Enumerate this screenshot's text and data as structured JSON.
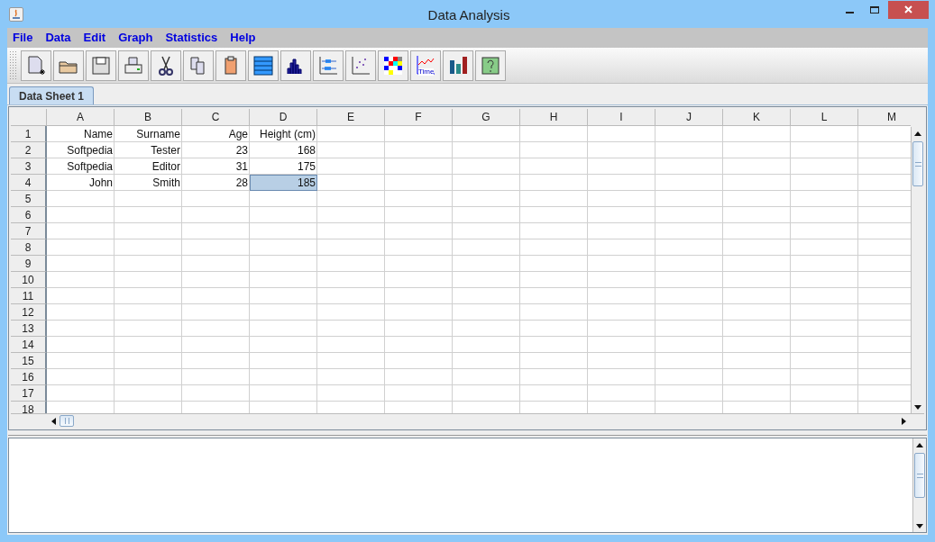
{
  "window": {
    "title": "Data Analysis"
  },
  "menu": [
    "File",
    "Data",
    "Edit",
    "Graph",
    "Statistics",
    "Help"
  ],
  "toolbar": [
    {
      "kind": "new"
    },
    {
      "kind": "open"
    },
    {
      "kind": "save"
    },
    {
      "kind": "print"
    },
    {
      "kind": "cut"
    },
    {
      "kind": "copy"
    },
    {
      "kind": "paste"
    },
    {
      "kind": "sheet"
    },
    {
      "kind": "histogram"
    },
    {
      "kind": "boxplot"
    },
    {
      "kind": "scatter"
    },
    {
      "kind": "matrix"
    },
    {
      "kind": "timeseries",
      "label": "Time"
    },
    {
      "kind": "bars"
    },
    {
      "kind": "help"
    }
  ],
  "tabs": [
    {
      "label": "Data Sheet 1",
      "selected": true
    }
  ],
  "table": {
    "columns": [
      "A",
      "B",
      "C",
      "D",
      "E",
      "F",
      "G",
      "H",
      "I",
      "J",
      "K",
      "L",
      "M"
    ],
    "rows": [
      {
        "header": "1",
        "cells": [
          {
            "text": "Name",
            "selected": false
          },
          {
            "text": "Surname",
            "selected": false
          },
          {
            "text": "Age",
            "selected": false
          },
          {
            "text": "Height (cm)",
            "selected": false
          }
        ]
      },
      {
        "header": "2",
        "cells": [
          {
            "text": "Softpedia",
            "selected": false
          },
          {
            "text": "Tester",
            "selected": false
          },
          {
            "text": "23",
            "selected": false
          },
          {
            "text": "168",
            "selected": false
          }
        ]
      },
      {
        "header": "3",
        "cells": [
          {
            "text": "Softpedia",
            "selected": false
          },
          {
            "text": "Editor",
            "selected": false
          },
          {
            "text": "31",
            "selected": false
          },
          {
            "text": "175",
            "selected": false
          }
        ]
      },
      {
        "header": "4",
        "cells": [
          {
            "text": "John",
            "selected": false
          },
          {
            "text": "Smith",
            "selected": false
          },
          {
            "text": "28",
            "selected": false
          },
          {
            "text": "185",
            "selected": true
          }
        ]
      },
      {
        "header": "5"
      },
      {
        "header": "6"
      },
      {
        "header": "7"
      },
      {
        "header": "8"
      },
      {
        "header": "9"
      },
      {
        "header": "10"
      },
      {
        "header": "11"
      },
      {
        "header": "12"
      },
      {
        "header": "13"
      },
      {
        "header": "14"
      },
      {
        "header": "15"
      },
      {
        "header": "16"
      },
      {
        "header": "17"
      },
      {
        "header": "18"
      }
    ]
  }
}
